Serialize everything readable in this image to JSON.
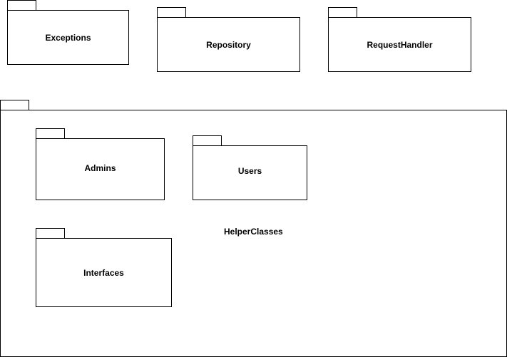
{
  "diagram": {
    "packages": {
      "exceptions": "Exceptions",
      "repository": "Repository",
      "request_handler": "RequestHandler",
      "helper_classes": "HelperClasses",
      "admins": "Admins",
      "users": "Users",
      "interfaces": "Interfaces"
    },
    "colors": {
      "stroke": "#000000",
      "fill": "#ffffff",
      "text": "#000000"
    }
  }
}
